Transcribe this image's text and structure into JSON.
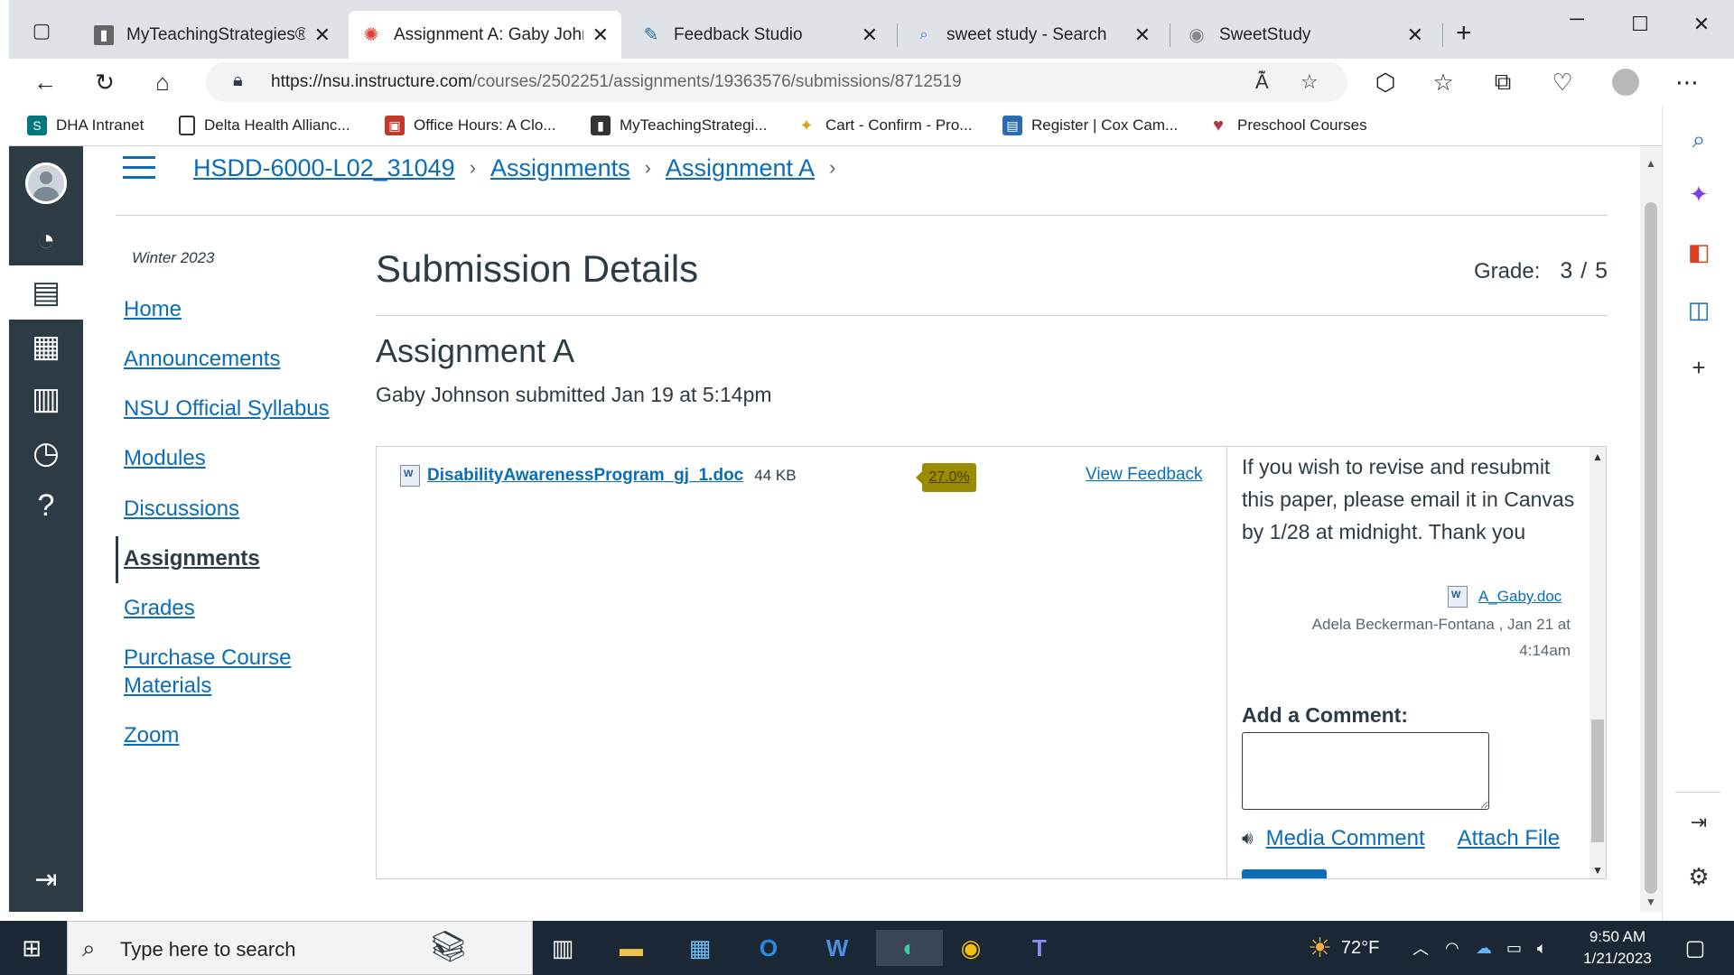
{
  "browser": {
    "tabs": [
      {
        "title": "MyTeachingStrategies® - ",
        "icon": "book-icon",
        "active": false
      },
      {
        "title": "Assignment A: Gaby John",
        "icon": "canvas-icon",
        "active": true
      },
      {
        "title": "Feedback Studio",
        "icon": "feedback-studio-icon",
        "active": false
      },
      {
        "title": "sweet study - Search",
        "icon": "search-icon",
        "active": false
      },
      {
        "title": "SweetStudy",
        "icon": "sweetstudy-icon",
        "active": false
      }
    ],
    "url_host": "https://nsu.instructure.com",
    "url_path": "/courses/2502251/assignments/19363576/submissions/8712519",
    "favorites": [
      {
        "label": "DHA Intranet",
        "icon": "sharepoint-icon"
      },
      {
        "label": "Delta Health Allianc...",
        "icon": "page-icon"
      },
      {
        "label": "Office Hours: A Clo...",
        "icon": "office-hours-icon"
      },
      {
        "label": "MyTeachingStrategi...",
        "icon": "book-icon"
      },
      {
        "label": "Cart - Confirm - Pro...",
        "icon": "cart-icon"
      },
      {
        "label": "Register | Cox Cam...",
        "icon": "register-icon"
      },
      {
        "label": "Preschool Courses",
        "icon": "heart-icon"
      }
    ]
  },
  "breadcrumb": {
    "course": "HSDD-6000-L02_31049",
    "assignments": "Assignments",
    "assignment": "Assignment A",
    "separator": "›"
  },
  "course_nav": {
    "term": "Winter 2023",
    "items": [
      {
        "label": "Home",
        "active": false
      },
      {
        "label": "Announcements",
        "active": false
      },
      {
        "label": "NSU Official Syllabus",
        "active": false
      },
      {
        "label": "Modules",
        "active": false
      },
      {
        "label": "Discussions",
        "active": false
      },
      {
        "label": "Assignments",
        "active": true
      },
      {
        "label": "Grades",
        "active": false
      },
      {
        "label": "Purchase Course",
        "active": false
      },
      {
        "label": "Materials",
        "active": false
      },
      {
        "label": "Zoom",
        "active": false
      }
    ]
  },
  "submission": {
    "page_title": "Submission Details",
    "grade_label": "Grade:",
    "grade_value": "3 / 5",
    "assignment_title": "Assignment A",
    "submitted_text": "Gaby Johnson submitted Jan 19 at 5:14pm",
    "file_name": "DisabilityAwarenessProgram_gj_1.doc",
    "file_size": "44 KB",
    "similarity_score": "27.0%",
    "view_feedback": "View Feedback"
  },
  "comments": {
    "text": "If you wish to revise and resubmit this paper, please email it in Canvas by 1/28 at midnight. Thank you",
    "attachment": "A_Gaby.doc",
    "author_line": "Adela Beckerman-Fontana , Jan 21 at",
    "time_line": "4:14am",
    "add_label": "Add a Comment:",
    "media_comment": "Media Comment",
    "attach_file": "Attach File"
  },
  "taskbar": {
    "search_placeholder": "Type here to search",
    "weather": "72°F",
    "time": "9:50 AM",
    "date": "1/21/2023"
  },
  "colors": {
    "canvas_nav": "#2d3b45",
    "link": "#0b6cb8",
    "score_badge": "#9a8b00",
    "taskbar": "#1c2735"
  }
}
